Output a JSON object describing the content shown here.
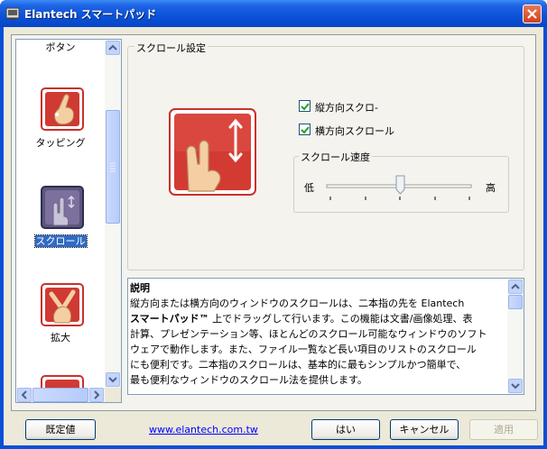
{
  "window": {
    "title": "Elantech スマートパッド"
  },
  "sidebar": {
    "items": [
      {
        "label": "ボタン"
      },
      {
        "label": "タッピング"
      },
      {
        "label": "スクロール"
      },
      {
        "label": "拡大"
      }
    ]
  },
  "scroll_settings": {
    "group_title": "スクロール設定",
    "vertical_scroll": {
      "label": "縦方向スクロ-",
      "checked": true
    },
    "horizontal_scroll": {
      "label": "横方向スクロール",
      "checked": true
    },
    "speed": {
      "group_title": "スクロール速度",
      "low_label": "低",
      "high_label": "高",
      "level": 0.5
    }
  },
  "description": {
    "heading": "説明",
    "line1": "縦方向または横方向のウィンドウのスクロールは、二本指の先を Elantech",
    "line2_bold": "スマートパッド™",
    "line2_rest": " 上でドラッグして行います。この機能は文書/画像処理、表",
    "line3": "計算、プレゼンテーション等、ほとんどのスクロール可能なウィンドウのソフト",
    "line4": "ウェアで動作します。また、ファイル一覧など長い項目のリストのスクロール",
    "line5": "にも便利です。二本指のスクロールは、基本的に最もシンプルかつ簡単で、",
    "line6": "最も便利なウィンドウのスクロール法を提供します。"
  },
  "footer": {
    "defaults_label": "既定値",
    "link": "www.elantech.com.tw",
    "ok_label": "はい",
    "cancel_label": "キャンセル",
    "apply_label": "適用"
  }
}
